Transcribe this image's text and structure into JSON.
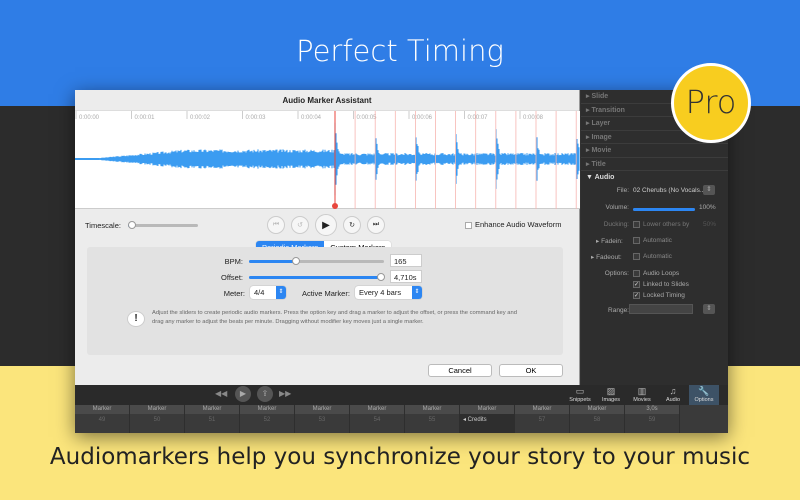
{
  "headline": "Perfect Timing",
  "caption": "Audiomarkers help you synchronize your story to your music",
  "badge": "Pro",
  "colors": {
    "accent": "#2c86f2",
    "marker": "#e8463c",
    "blue_band": "#2f7de6",
    "yellow_band": "#fbe57c",
    "badge": "#f8cd1f"
  },
  "dialog": {
    "title": "Audio Marker Assistant",
    "time_labels": [
      "0:00:00",
      "0:00:01",
      "0:00:02",
      "0:00:03",
      "0:00:04",
      "0:00:05",
      "0:00:06",
      "0:00:07",
      "0:00:08"
    ],
    "timescale_label": "Timescale:",
    "timescale_value": 0.05,
    "transport": [
      {
        "icon": "skip-back-icon",
        "glyph": "⏮"
      },
      {
        "icon": "rewind-icon",
        "glyph": "↺"
      },
      {
        "icon": "play-icon",
        "glyph": "▶"
      },
      {
        "icon": "forward-icon",
        "glyph": "↻"
      },
      {
        "icon": "skip-forward-icon",
        "glyph": "⏭"
      }
    ],
    "enhance_label": "Enhance Audio Waveform",
    "enhance_checked": false,
    "tabs": [
      "Periodic Markers",
      "Custom Markers"
    ],
    "active_tab": 0,
    "bpm_label": "BPM:",
    "bpm_value": "165",
    "bpm_slider": 0.35,
    "offset_label": "Offset:",
    "offset_value": "4,710s",
    "offset_slider": 0.98,
    "meter_label": "Meter:",
    "meter_value": "4/4",
    "active_marker_label": "Active Marker:",
    "active_marker_value": "Every 4 bars",
    "info_icon": "warning-icon",
    "info_text": "Adjust the sliders to create periodic audio markers. Press the option key and drag a marker to adjust the offset, or press the command key and drag any marker to adjust the beats per minute. Dragging without modifier key moves just a single marker.",
    "cancel": "Cancel",
    "ok": "OK"
  },
  "inspector": {
    "sections": [
      "Slide",
      "Transition",
      "Layer",
      "Image",
      "Movie",
      "Title"
    ],
    "audio": "Audio",
    "file_label": "File:",
    "file_value": "02 Cherubs (No Vocals...",
    "volume_label": "Volume:",
    "volume_value": "100%",
    "volume_level": 1.0,
    "ducking_label": "Ducking:",
    "ducking_text": "Lower others by",
    "ducking_value": "50%",
    "fadein_label": "Fadein:",
    "fadein_text": "Automatic",
    "fadeout_label": "Fadeout:",
    "fadeout_text": "Automatic",
    "options_label": "Options:",
    "options": [
      {
        "label": "Audio Loops",
        "checked": false
      },
      {
        "label": "Linked to Slides",
        "checked": true
      },
      {
        "label": "Locked Timing",
        "checked": true
      }
    ],
    "range_label": "Range:"
  },
  "toolbar": [
    {
      "label": "Snippets",
      "icon": "snippets-icon",
      "glyph": "▭"
    },
    {
      "label": "Images",
      "icon": "images-icon",
      "glyph": "▨"
    },
    {
      "label": "Movies",
      "icon": "movies-icon",
      "glyph": "▥"
    },
    {
      "label": "Audio",
      "icon": "music-note-icon",
      "glyph": "♫"
    },
    {
      "label": "Options",
      "icon": "wrench-icon",
      "glyph": "🔧"
    }
  ],
  "timeline": [
    {
      "head": "Marker",
      "num": "49"
    },
    {
      "head": "Marker",
      "num": "50"
    },
    {
      "head": "Marker",
      "num": "51"
    },
    {
      "head": "Marker",
      "num": "52"
    },
    {
      "head": "Marker",
      "num": "53"
    },
    {
      "head": "Marker",
      "num": "54"
    },
    {
      "head": "Marker",
      "num": "55"
    },
    {
      "head": "Marker",
      "num": "◂ Credits"
    },
    {
      "head": "Marker",
      "num": "57"
    },
    {
      "head": "Marker",
      "num": "58"
    },
    {
      "head": "3,0s",
      "num": "59"
    }
  ]
}
